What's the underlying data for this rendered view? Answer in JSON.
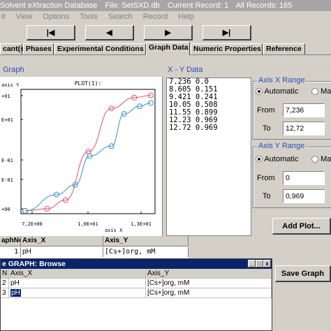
{
  "window": {
    "title_parts": [
      "Solvent eXtraction Database",
      "File: SetSXD.db",
      "Current Record: 1",
      "All Records: 165"
    ]
  },
  "menu": [
    "it",
    "View",
    "Options",
    "Tools",
    "Search",
    "Record",
    "Help"
  ],
  "nav_buttons": [
    {
      "label": "|◀",
      "icon": "first-record-icon"
    },
    {
      "label": "◀",
      "icon": "prev-record-icon"
    },
    {
      "label": "▶",
      "icon": "next-record-icon"
    },
    {
      "label": "▶|",
      "icon": "last-record-icon"
    }
  ],
  "tabs": [
    "cant(s)",
    "Phases",
    "Experimental Conditions",
    "Graph Data",
    "Numeric Properties",
    "Reference"
  ],
  "active_tab": "Graph Data",
  "graph_label": "Graph",
  "xy_label": "X - Y Data",
  "plot": {
    "title": "PLOT(1):",
    "y_label": "axis Y",
    "x_label": "axis X",
    "y_ticks": [
      "+01",
      "E+01",
      "E-01",
      "E-01",
      "+00"
    ],
    "x_ticks": [
      "7,2E+00",
      "1,0E+01",
      "1,3E+01"
    ]
  },
  "xy_data": [
    "7.236 0.0",
    "8.605 0.151",
    "9.421 0.241",
    "10.05 0.508",
    "11.55 0.899",
    "12.23 0.969",
    "12.72 0.969"
  ],
  "axis_x_range": {
    "title": "Axis X Range",
    "automatic_label": "Automatic",
    "manual_label": "Ma",
    "from_label": "From",
    "from_value": "7,236",
    "to_label": "To",
    "to_value": "12,72"
  },
  "axis_y_range": {
    "title": "Axis Y Range",
    "automatic_label": "Automatic",
    "manual_label": "Ma",
    "from_label": "From",
    "from_value": "0",
    "to_label": "To",
    "to_value": "0,969"
  },
  "add_plot_label": "Add Plot...",
  "save_graph_label": "Save Graph",
  "grid": {
    "headers": [
      "aphNo",
      "Axis_X",
      "Axis_Y"
    ],
    "rows": [
      [
        "1",
        "pH",
        "[Cs+]org, mM"
      ]
    ]
  },
  "browse": {
    "title": "e GRAPH: Browse",
    "win_buttons": [
      "_",
      "□",
      "x"
    ],
    "headers": [
      "N",
      "Axis_X",
      "Axis_Y"
    ],
    "rows": [
      [
        "2",
        "pH",
        "[Cs+]org, mM"
      ],
      [
        "3",
        "pH",
        "[Cs+]org, mM"
      ]
    ]
  },
  "chart_data": {
    "type": "line",
    "title": "PLOT(1):",
    "xlabel": "axis X",
    "ylabel": "axis Y",
    "series": [
      {
        "name": "",
        "color": "#e0506e",
        "x": [
          7.236,
          8.2,
          9.0,
          10.0,
          11.0,
          12.0,
          12.72
        ],
        "y": [
          0.0,
          0.02,
          0.1,
          0.55,
          0.95,
          1.05,
          1.07
        ]
      },
      {
        "name": "",
        "color": "#3a8fc8",
        "x": [
          7.236,
          8.605,
          9.421,
          10.05,
          11.0,
          11.55,
          12.23,
          12.72
        ],
        "y": [
          0.0,
          0.151,
          0.241,
          0.508,
          0.6,
          0.899,
          0.969,
          1.0
        ]
      }
    ]
  }
}
